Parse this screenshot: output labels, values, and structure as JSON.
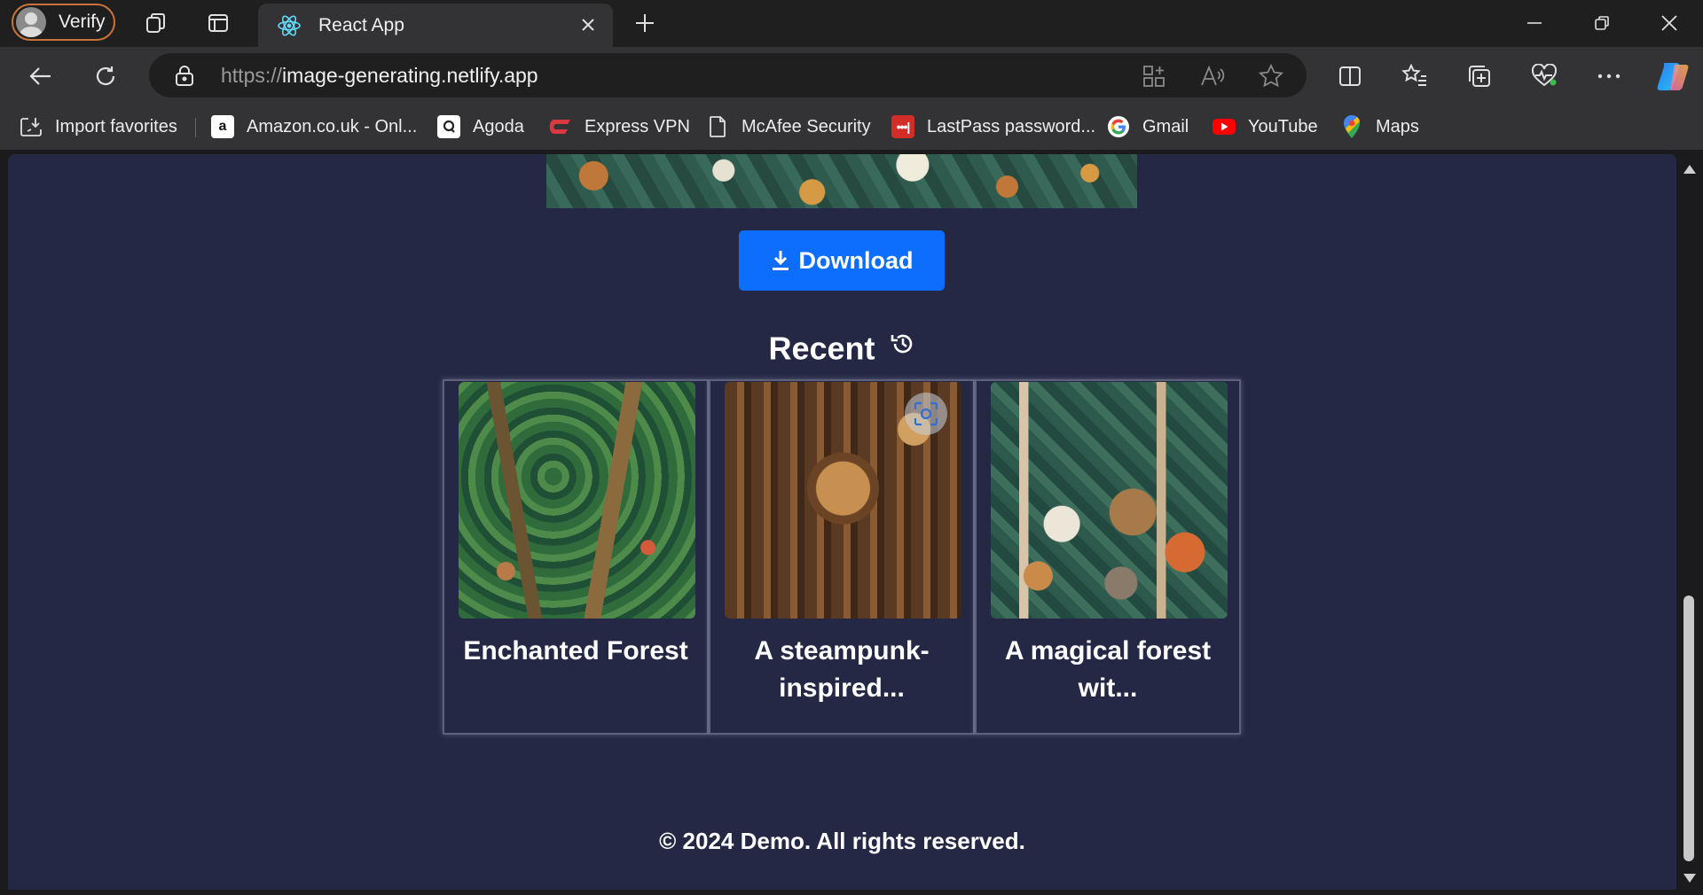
{
  "browser": {
    "profile_label": "Verify",
    "tab": {
      "title": "React App"
    },
    "address": {
      "scheme": "https://",
      "host": "image-generating.netlify.app"
    },
    "favorites": [
      {
        "label": "Import favorites",
        "icon": "import-favorites-icon"
      },
      {
        "label": "Amazon.co.uk - Onl...",
        "icon": "amazon-icon"
      },
      {
        "label": "Agoda",
        "icon": "agoda-icon"
      },
      {
        "label": "Express VPN",
        "icon": "expressvpn-icon"
      },
      {
        "label": "McAfee Security",
        "icon": "document-icon"
      },
      {
        "label": "LastPass password...",
        "icon": "lastpass-icon"
      },
      {
        "label": "Gmail",
        "icon": "google-icon"
      },
      {
        "label": "YouTube",
        "icon": "youtube-icon"
      },
      {
        "label": "Maps",
        "icon": "maps-pin-icon"
      }
    ]
  },
  "page": {
    "download_label": "Download",
    "recent_title": "Recent",
    "recent_items": [
      {
        "caption": "Enchanted Forest",
        "image": "enchanted-forest-illustration"
      },
      {
        "caption": "A steampunk-inspired...",
        "image": "steampunk-city-illustration"
      },
      {
        "caption": "A magical forest wit...",
        "image": "forest-animals-illustration"
      }
    ],
    "footer": "© 2024 Demo. All rights reserved."
  },
  "colors": {
    "page_background": "#252845",
    "download_button": "#0d6efd",
    "browser_chrome": "#333336",
    "title_bar": "#1f1f1f"
  }
}
